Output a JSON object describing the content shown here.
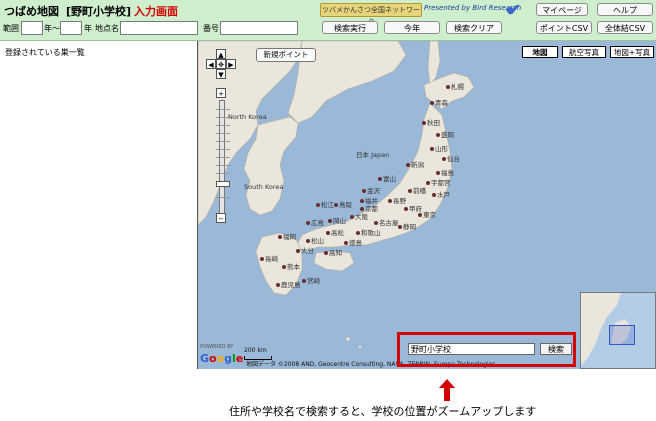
{
  "header": {
    "app_title": "つばめ地図",
    "school": "[野町小学校]",
    "mode": "入力画面",
    "network_badge": "ツバメかんさつ全国ネットワーク",
    "presented_by": "Presented by Bird Research",
    "buttons": {
      "mypage": "マイページ",
      "help": "ヘルプ",
      "search_exec": "検索実行",
      "this_year": "今年",
      "search_clear": "検索クリア",
      "point_csv": "ポイントCSV",
      "all_csv": "全体結CSV"
    },
    "filters": {
      "range_label": "範囲",
      "year_from_suffix": "年〜",
      "year_to_suffix": "年",
      "place_label": "地点名",
      "number_label": "番号"
    }
  },
  "left_pane": {
    "title": "登録されている巣一覧"
  },
  "map": {
    "new_point": "新規ポイント",
    "types": [
      "地図",
      "航空写真",
      "地図+写真"
    ],
    "active_type": "地図",
    "countries": {
      "north_korea": "North Korea",
      "south_korea": "South Korea",
      "japan": "日本 Japan"
    },
    "cities": [
      "札幌",
      "青森",
      "秋田",
      "盛岡",
      "山形",
      "仙台",
      "新潟",
      "福島",
      "富山",
      "宇都宮",
      "金沢",
      "前橋",
      "水戸",
      "福井",
      "長野",
      "甲府",
      "松江",
      "鳥取",
      "大阪",
      "広島",
      "岡山",
      "京都",
      "名古屋",
      "東京",
      "静岡",
      "高松",
      "和歌山",
      "松山",
      "福岡",
      "大分",
      "徳島",
      "高知",
      "長崎",
      "熊本",
      "宮崎",
      "鹿児島"
    ],
    "search": {
      "value": "野町小学校",
      "button": "検索"
    },
    "scale_label": "200 km",
    "copyright": "地図データ ©2008 AND, Geocentre Consulting, NASA, ZENRIN, Europa Technologies",
    "logo": "Google",
    "powered_by": "POWERED BY",
    "colors": {
      "sea": "#9ab8d8",
      "land": "#eae6dc",
      "highlight": "#d40000"
    }
  },
  "annotation": {
    "caption": "住所や学校名で検索すると、学校の位置がズームアップします"
  }
}
